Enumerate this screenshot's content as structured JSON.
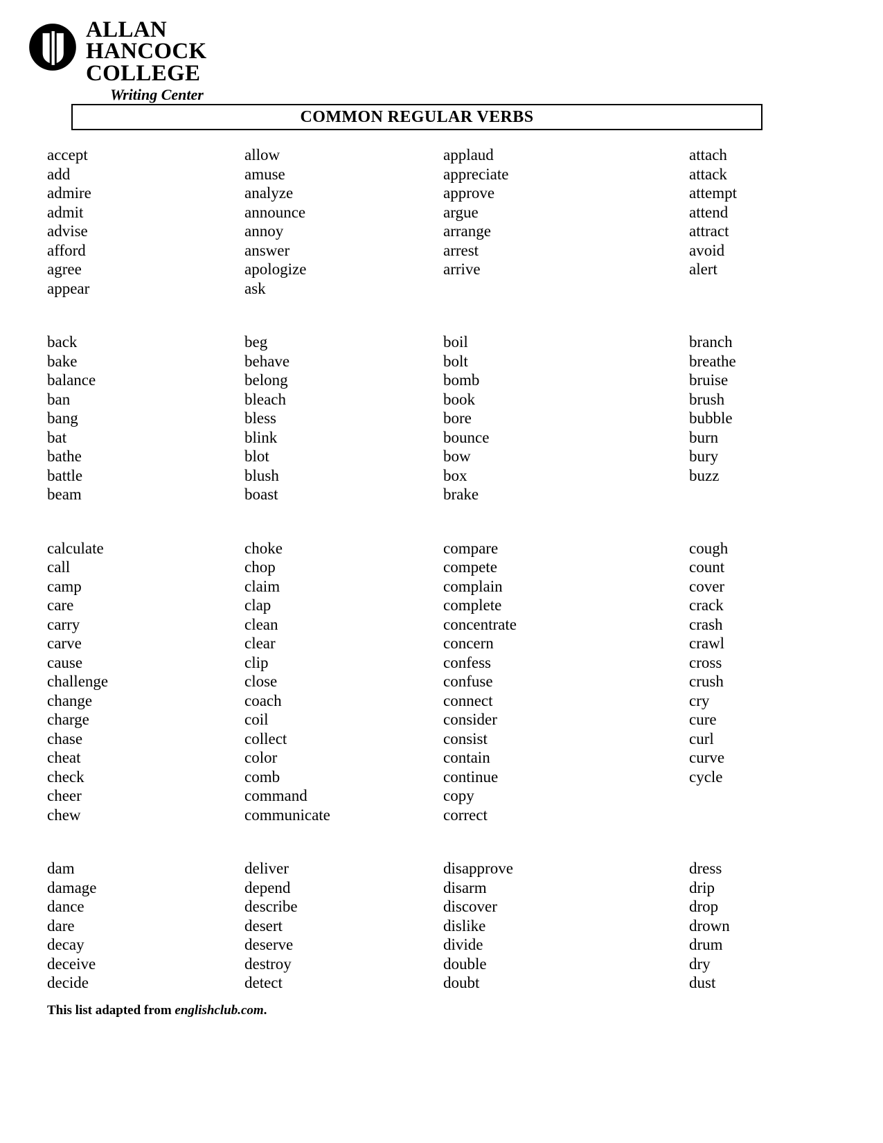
{
  "logo": {
    "line1": "ALLAN",
    "line2": "HANCOCK",
    "line3": "COLLEGE",
    "subtitle": "Writing Center",
    "mark": "hancock-seal-icon"
  },
  "title": "COMMON REGULAR VERBS",
  "groups": [
    {
      "letter": "a",
      "columns": [
        [
          "accept",
          "add",
          "admire",
          "admit",
          "advise",
          "afford",
          "agree",
          "appear"
        ],
        [
          "allow",
          "amuse",
          "analyze",
          "announce",
          "annoy",
          "answer",
          "apologize",
          "ask"
        ],
        [
          "applaud",
          "appreciate",
          "approve",
          "argue",
          "arrange",
          "arrest",
          "arrive"
        ],
        [
          "attach",
          "attack",
          "attempt",
          "attend",
          "attract",
          "avoid",
          "alert"
        ]
      ]
    },
    {
      "letter": "b",
      "columns": [
        [
          "back",
          "bake",
          "balance",
          "ban",
          "bang",
          "bat",
          "bathe",
          "battle",
          "beam"
        ],
        [
          "beg",
          "behave",
          "belong",
          "bleach",
          "bless",
          "blink",
          "blot",
          "blush",
          "boast"
        ],
        [
          "boil",
          "bolt",
          "bomb",
          "book",
          "bore",
          "bounce",
          "bow",
          "box",
          "brake"
        ],
        [
          "branch",
          "breathe",
          "bruise",
          "brush",
          "bubble",
          "burn",
          "bury",
          "buzz"
        ]
      ]
    },
    {
      "letter": "c",
      "columns": [
        [
          "calculate",
          "call",
          "camp",
          "care",
          "carry",
          "carve",
          "cause",
          "challenge",
          "change",
          "charge",
          "chase",
          "cheat",
          "check",
          "cheer",
          "chew"
        ],
        [
          "choke",
          "chop",
          "claim",
          "clap",
          "clean",
          "clear",
          "clip",
          "close",
          "coach",
          "coil",
          "collect",
          "color",
          "comb",
          "command",
          "communicate"
        ],
        [
          "compare",
          "compete",
          "complain",
          "complete",
          "concentrate",
          "concern",
          "confess",
          "confuse",
          "connect",
          "consider",
          "consist",
          "contain",
          "continue",
          "copy",
          "correct"
        ],
        [
          "cough",
          "count",
          "cover",
          "crack",
          "crash",
          "crawl",
          "cross",
          "crush",
          "cry",
          "cure",
          "curl",
          "curve",
          "cycle"
        ]
      ]
    },
    {
      "letter": "d",
      "columns": [
        [
          "dam",
          "damage",
          "dance",
          "dare",
          "decay",
          "deceive",
          "decide"
        ],
        [
          "deliver",
          "depend",
          "describe",
          "desert",
          "deserve",
          "destroy",
          "detect"
        ],
        [
          "disapprove",
          "disarm",
          "discover",
          "dislike",
          "divide",
          "double",
          "doubt"
        ],
        [
          "dress",
          "drip",
          "drop",
          "drown",
          "drum",
          "dry",
          "dust"
        ]
      ]
    }
  ],
  "footer": {
    "prefix": "This list adapted from ",
    "site": "englishclub.com",
    "suffix": "."
  }
}
